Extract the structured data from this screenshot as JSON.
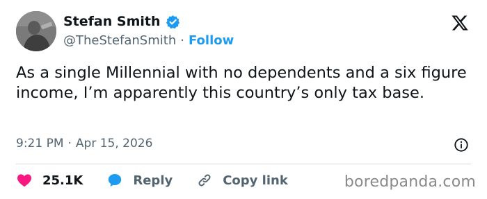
{
  "user": {
    "display_name": "Stefan Smith",
    "handle": "@TheStefanSmith",
    "separator": "·",
    "follow_label": "Follow"
  },
  "tweet": {
    "text": "As a single Millennial with no dependents and a six figure income, I’m apparently this country’s only tax base.",
    "time": "9:21 PM",
    "separator": "·",
    "date": "Apr 15, 2026"
  },
  "actions": {
    "likes_count": "25.1K",
    "reply_label": "Reply",
    "copy_label": "Copy link"
  },
  "watermark": "boredpanda.com",
  "colors": {
    "accent": "#1d9bf0",
    "like": "#f91880",
    "text": "#0f1419",
    "muted": "#536471"
  },
  "icons": {
    "verified": "verified-badge-icon",
    "logo": "x-logo-icon",
    "info": "info-icon",
    "like": "heart-icon",
    "reply": "speech-bubble-icon",
    "copy": "link-icon"
  }
}
